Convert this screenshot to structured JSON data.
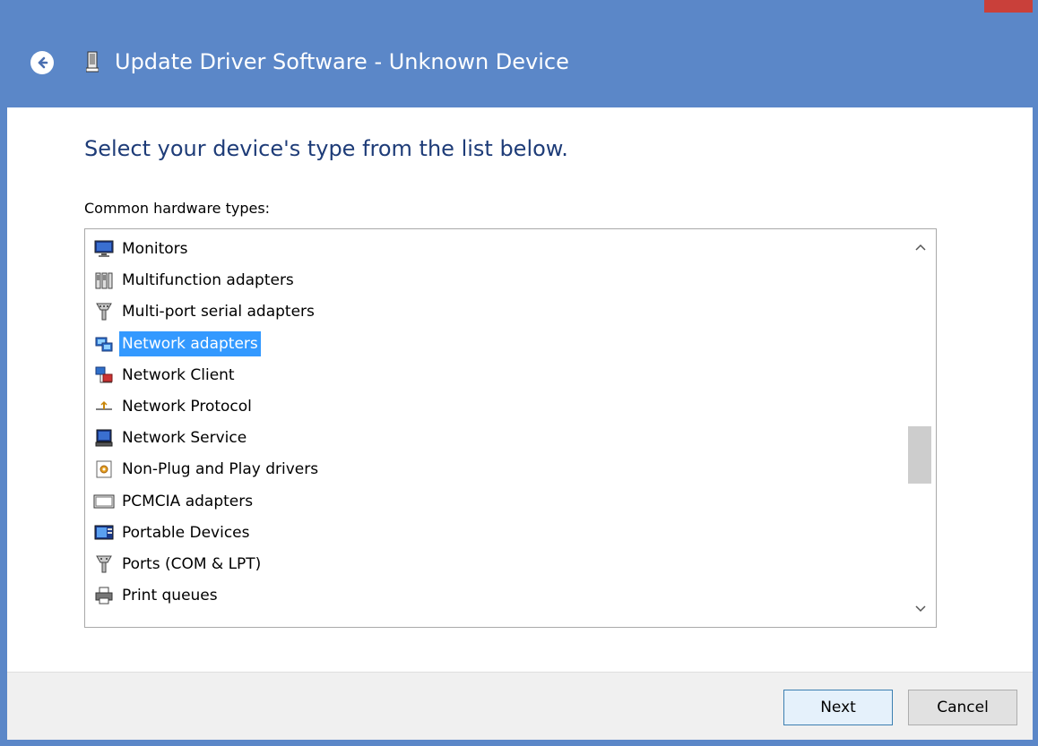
{
  "window": {
    "title": "Update Driver Software - Unknown Device",
    "back_icon": "back-arrow-icon",
    "device_icon": "device-icon"
  },
  "main": {
    "heading": "Select your device's type from the list below.",
    "list_label": "Common hardware types:"
  },
  "hardware_types": {
    "items": [
      {
        "label": "Monitors",
        "icon": "monitor-icon",
        "selected": false
      },
      {
        "label": "Multifunction adapters",
        "icon": "multifunction-icon",
        "selected": false
      },
      {
        "label": "Multi-port serial adapters",
        "icon": "serial-port-icon",
        "selected": false
      },
      {
        "label": "Network adapters",
        "icon": "network-adapter-icon",
        "selected": true
      },
      {
        "label": "Network Client",
        "icon": "network-client-icon",
        "selected": false
      },
      {
        "label": "Network Protocol",
        "icon": "network-protocol-icon",
        "selected": false
      },
      {
        "label": "Network Service",
        "icon": "network-service-icon",
        "selected": false
      },
      {
        "label": "Non-Plug and Play drivers",
        "icon": "non-pnp-icon",
        "selected": false
      },
      {
        "label": "PCMCIA adapters",
        "icon": "pcmcia-icon",
        "selected": false
      },
      {
        "label": "Portable Devices",
        "icon": "portable-device-icon",
        "selected": false
      },
      {
        "label": "Ports (COM & LPT)",
        "icon": "ports-icon",
        "selected": false
      },
      {
        "label": "Print queues",
        "icon": "printer-icon",
        "selected": false
      }
    ],
    "scroll_position": 0.6
  },
  "buttons": {
    "next": "Next",
    "cancel": "Cancel"
  },
  "colors": {
    "titlebar": "#5b87c8",
    "heading": "#1e3c78",
    "selection": "#3399ff",
    "close": "#c9403a"
  }
}
